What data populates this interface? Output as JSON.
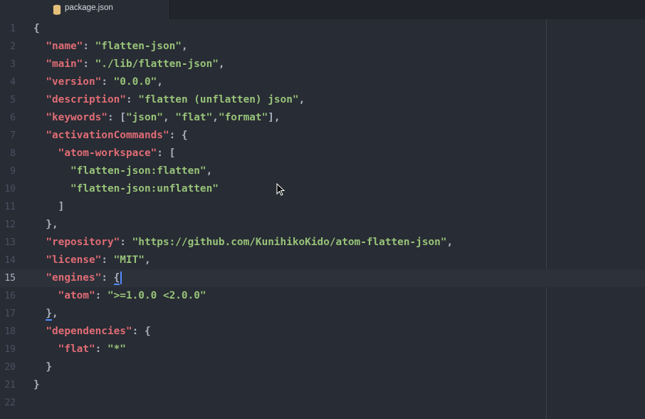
{
  "tab": {
    "title": "package.json",
    "icon": "database-icon"
  },
  "editor": {
    "active_line": 15,
    "lines": [
      {
        "n": "1",
        "tokens": [
          [
            "p",
            "{"
          ]
        ]
      },
      {
        "n": "2",
        "tokens": [
          [
            "p",
            "  "
          ],
          [
            "k",
            "\"name\""
          ],
          [
            "p",
            ": "
          ],
          [
            "s",
            "\"flatten-json\""
          ],
          [
            "p",
            ","
          ]
        ]
      },
      {
        "n": "3",
        "tokens": [
          [
            "p",
            "  "
          ],
          [
            "k",
            "\"main\""
          ],
          [
            "p",
            ": "
          ],
          [
            "s",
            "\"./lib/flatten-json\""
          ],
          [
            "p",
            ","
          ]
        ]
      },
      {
        "n": "4",
        "tokens": [
          [
            "p",
            "  "
          ],
          [
            "k",
            "\"version\""
          ],
          [
            "p",
            ": "
          ],
          [
            "s",
            "\"0.0.0\""
          ],
          [
            "p",
            ","
          ]
        ]
      },
      {
        "n": "5",
        "tokens": [
          [
            "p",
            "  "
          ],
          [
            "k",
            "\"description\""
          ],
          [
            "p",
            ": "
          ],
          [
            "s",
            "\"flatten (unflatten) json\""
          ],
          [
            "p",
            ","
          ]
        ]
      },
      {
        "n": "6",
        "tokens": [
          [
            "p",
            "  "
          ],
          [
            "k",
            "\"keywords\""
          ],
          [
            "p",
            ": ["
          ],
          [
            "s",
            "\"json\""
          ],
          [
            "p",
            ", "
          ],
          [
            "s",
            "\"flat\""
          ],
          [
            "p",
            ","
          ],
          [
            "s",
            "\"format\""
          ],
          [
            "p",
            "],"
          ]
        ]
      },
      {
        "n": "7",
        "tokens": [
          [
            "p",
            "  "
          ],
          [
            "k",
            "\"activationCommands\""
          ],
          [
            "p",
            ": {"
          ]
        ]
      },
      {
        "n": "8",
        "tokens": [
          [
            "p",
            "    "
          ],
          [
            "k",
            "\"atom-workspace\""
          ],
          [
            "p",
            ": ["
          ]
        ]
      },
      {
        "n": "9",
        "tokens": [
          [
            "p",
            "      "
          ],
          [
            "s",
            "\"flatten-json:flatten\""
          ],
          [
            "p",
            ","
          ]
        ]
      },
      {
        "n": "10",
        "tokens": [
          [
            "p",
            "      "
          ],
          [
            "s",
            "\"flatten-json:unflatten\""
          ]
        ]
      },
      {
        "n": "11",
        "tokens": [
          [
            "p",
            "    ]"
          ]
        ]
      },
      {
        "n": "12",
        "tokens": [
          [
            "p",
            "  },"
          ]
        ]
      },
      {
        "n": "13",
        "tokens": [
          [
            "p",
            "  "
          ],
          [
            "k",
            "\"repository\""
          ],
          [
            "p",
            ": "
          ],
          [
            "s",
            "\"https://github.com/KunihikoKido/atom-flatten-json\""
          ],
          [
            "p",
            ","
          ]
        ]
      },
      {
        "n": "14",
        "tokens": [
          [
            "p",
            "  "
          ],
          [
            "k",
            "\"license\""
          ],
          [
            "p",
            ": "
          ],
          [
            "s",
            "\"MIT\""
          ],
          [
            "p",
            ","
          ]
        ]
      },
      {
        "n": "15",
        "tokens": [
          [
            "p",
            "  "
          ],
          [
            "k",
            "\"engines\""
          ],
          [
            "p",
            ": "
          ],
          [
            "pb",
            "{"
          ]
        ]
      },
      {
        "n": "16",
        "tokens": [
          [
            "p",
            "    "
          ],
          [
            "k",
            "\"atom\""
          ],
          [
            "p",
            ": "
          ],
          [
            "s",
            "\">=1.0.0 <2.0.0\""
          ]
        ]
      },
      {
        "n": "17",
        "tokens": [
          [
            "p",
            "  "
          ],
          [
            "pb",
            "}"
          ],
          [
            "p",
            ","
          ]
        ]
      },
      {
        "n": "18",
        "tokens": [
          [
            "p",
            "  "
          ],
          [
            "k",
            "\"dependencies\""
          ],
          [
            "p",
            ": {"
          ]
        ]
      },
      {
        "n": "19",
        "tokens": [
          [
            "p",
            "    "
          ],
          [
            "k",
            "\"flat\""
          ],
          [
            "p",
            ": "
          ],
          [
            "s",
            "\"*\""
          ]
        ]
      },
      {
        "n": "20",
        "tokens": [
          [
            "p",
            "  }"
          ]
        ]
      },
      {
        "n": "21",
        "tokens": [
          [
            "p",
            "}"
          ]
        ]
      },
      {
        "n": "22",
        "tokens": []
      }
    ]
  },
  "colors": {
    "key": "#e06c75",
    "string": "#98c379",
    "punctuation": "#abb2bf",
    "caret": "#528bff",
    "background": "#282c34"
  }
}
